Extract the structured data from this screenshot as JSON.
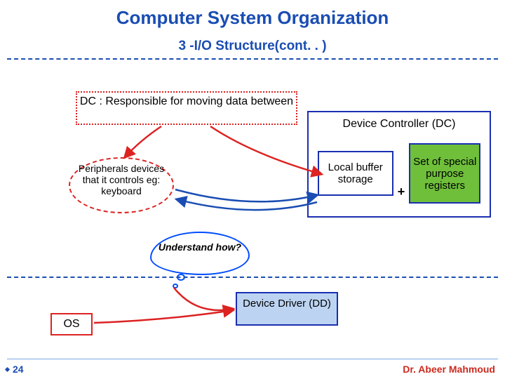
{
  "title": "Computer System Organization",
  "subtitle": "3 -I/O Structure(cont. . )",
  "dc_definition": "DC : Responsible for moving data between",
  "peripherals": "Peripherals devices that it controls eg: keyboard",
  "device_controller": {
    "label": "Device Controller (DC)",
    "local_buffer": "Local buffer storage",
    "plus": "+",
    "registers": "Set of special purpose registers"
  },
  "cloud": "Understand how?",
  "device_driver": "Device Driver (DD)",
  "os": "OS",
  "footer": {
    "page": "24",
    "author": "Dr. Abeer Mahmoud"
  }
}
